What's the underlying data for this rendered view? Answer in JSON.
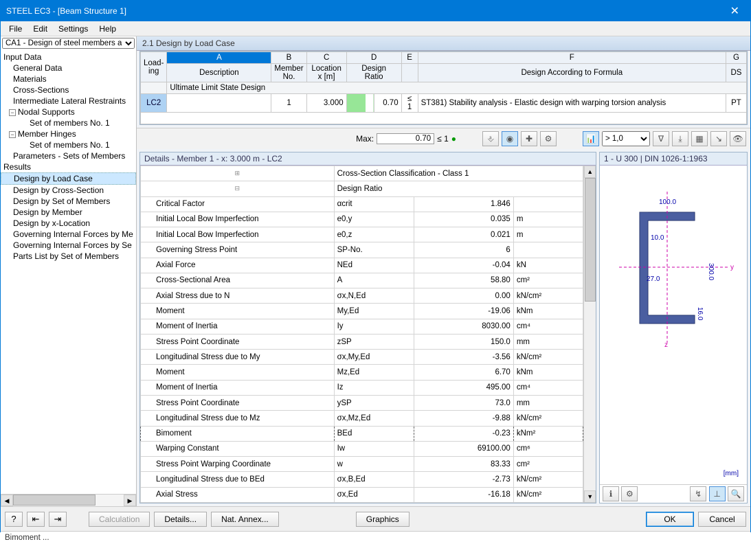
{
  "title": "STEEL EC3 - [Beam Structure 1]",
  "menu": {
    "file": "File",
    "edit": "Edit",
    "settings": "Settings",
    "help": "Help"
  },
  "moduleSelect": "CA1 - Design of steel members a",
  "tree": {
    "inputData": "Input Data",
    "generalData": "General Data",
    "materials": "Materials",
    "crossSections": "Cross-Sections",
    "ilr": "Intermediate Lateral Restraints",
    "nodal": "Nodal Supports",
    "set1a": "Set of members No. 1",
    "hinges": "Member Hinges",
    "set1b": "Set of members No. 1",
    "params": "Parameters - Sets of Members",
    "results": "Results",
    "r1": "Design by Load Case",
    "r2": "Design by Cross-Section",
    "r3": "Design by Set of Members",
    "r4": "Design by Member",
    "r5": "Design by x-Location",
    "r6": "Governing Internal Forces by Me",
    "r7": "Governing Internal Forces by Se",
    "r8": "Parts List by Set of Members"
  },
  "section": {
    "title": "2.1 Design by Load Case"
  },
  "gridHead": {
    "load": "Load-\ning",
    "A": "A",
    "B": "B",
    "C": "C",
    "D": "D",
    "E": "E",
    "F": "F",
    "G": "G",
    "desc": "Description",
    "memberNo": "Member\nNo.",
    "locx": "Location\nx [m]",
    "ratio": "Design\nRatio",
    "formula": "Design According to Formula",
    "ds": "DS"
  },
  "gridGroup": "Ultimate Limit State Design",
  "gridRow": {
    "lc": "LC2",
    "desc": "",
    "member": "1",
    "x": "3.000",
    "ratio": "0.70",
    "le": "≤ 1",
    "formula": "ST381) Stability analysis - Elastic design with warping torsion analysis",
    "ds": "PT"
  },
  "maxbar": {
    "label": "Max:",
    "value": "0.70",
    "le": "≤ 1",
    "filter": "> 1,0"
  },
  "details": {
    "title": "Details - Member 1 - x: 3.000 m - LC2",
    "csc": "Cross-Section Classification - Class 1",
    "dr": "Design Ratio",
    "rows": [
      {
        "d": "Critical Factor",
        "s": "αcrit",
        "v": "1.846",
        "u": ""
      },
      {
        "d": "Initial Local Bow Imperfection",
        "s": "e0,y",
        "v": "0.035",
        "u": "m"
      },
      {
        "d": "Initial Local Bow Imperfection",
        "s": "e0,z",
        "v": "0.021",
        "u": "m"
      },
      {
        "d": "Governing Stress Point",
        "s": "SP-No.",
        "v": "6",
        "u": ""
      },
      {
        "d": "Axial Force",
        "s": "NEd",
        "v": "-0.04",
        "u": "kN"
      },
      {
        "d": "Cross-Sectional Area",
        "s": "A",
        "v": "58.80",
        "u": "cm²"
      },
      {
        "d": "Axial Stress due to N",
        "s": "σx,N,Ed",
        "v": "0.00",
        "u": "kN/cm²"
      },
      {
        "d": "Moment",
        "s": "My,Ed",
        "v": "-19.06",
        "u": "kNm"
      },
      {
        "d": "Moment of Inertia",
        "s": "Iy",
        "v": "8030.00",
        "u": "cm⁴"
      },
      {
        "d": "Stress Point Coordinate",
        "s": "zSP",
        "v": "150.0",
        "u": "mm"
      },
      {
        "d": "Longitudinal Stress due to My",
        "s": "σx,My,Ed",
        "v": "-3.56",
        "u": "kN/cm²"
      },
      {
        "d": "Moment",
        "s": "Mz,Ed",
        "v": "6.70",
        "u": "kNm"
      },
      {
        "d": "Moment of Inertia",
        "s": "Iz",
        "v": "495.00",
        "u": "cm⁴"
      },
      {
        "d": "Stress Point Coordinate",
        "s": "ySP",
        "v": "73.0",
        "u": "mm"
      },
      {
        "d": "Longitudinal Stress due to Mz",
        "s": "σx,Mz,Ed",
        "v": "-9.88",
        "u": "kN/cm²"
      },
      {
        "d": "Bimoment",
        "s": "BEd",
        "v": "-0.23",
        "u": "kNm²",
        "sel": true
      },
      {
        "d": "Warping Constant",
        "s": "Iw",
        "v": "69100.00",
        "u": "cm⁶"
      },
      {
        "d": "Stress Point Warping Coordinate",
        "s": "w",
        "v": "83.33",
        "u": "cm²"
      },
      {
        "d": "Longitudinal Stress due to BEd",
        "s": "σx,B,Ed",
        "v": "-2.73",
        "u": "kN/cm²"
      },
      {
        "d": "Axial Stress",
        "s": "σx,Ed",
        "v": "-16.18",
        "u": "kN/cm²"
      }
    ]
  },
  "cs": {
    "title": "1 - U 300 | DIN 1026-1:1963",
    "dim1": "100.0",
    "dim2": "10.0",
    "dim3": "300.0",
    "dim4": "27.0",
    "dim5": "16.0",
    "unit": "[mm]"
  },
  "footer": {
    "calc": "Calculation",
    "details": "Details...",
    "annex": "Nat. Annex...",
    "graphics": "Graphics",
    "ok": "OK",
    "cancel": "Cancel"
  },
  "status": "Bimoment ..."
}
